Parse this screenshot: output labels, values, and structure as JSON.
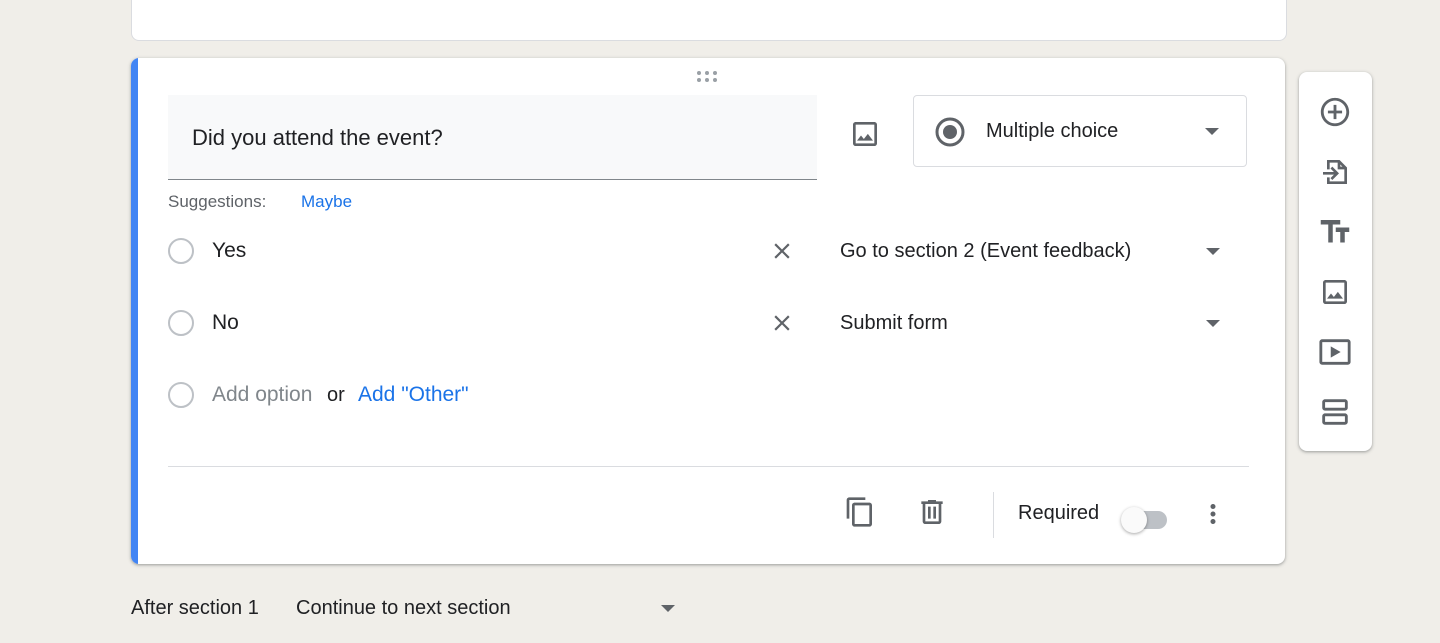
{
  "question": {
    "title": "Did you attend the event?",
    "type": "Multiple choice",
    "suggestions_label": "Suggestions:",
    "suggestion": "Maybe",
    "options": [
      {
        "label": "Yes",
        "goto": "Go to section 2 (Event feedback)"
      },
      {
        "label": "No",
        "goto": "Submit form"
      }
    ],
    "add_option": "Add option",
    "or": "or",
    "add_other": "Add \"Other\"",
    "required_label": "Required",
    "required": false
  },
  "toolbar": {
    "icons": [
      "add-question-icon",
      "import-questions-icon",
      "add-title-icon",
      "add-image-icon",
      "add-video-icon",
      "add-section-icon"
    ]
  },
  "after_section": {
    "label": "After section 1",
    "value": "Continue to next section"
  },
  "colors": {
    "accent": "#4285f4",
    "link": "#1a73e8",
    "icon": "#5f6368",
    "background": "#f0eee9"
  }
}
